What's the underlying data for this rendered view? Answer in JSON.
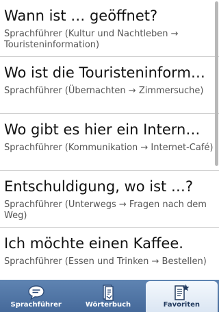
{
  "entries": [
    {
      "title": "Wann ist … geöffnet?",
      "subtitle": "Sprachführer (Kultur und Nachtleben → Touristeninformation)"
    },
    {
      "title": "Wo ist die Touristeninform…",
      "subtitle": "Sprachführer (Übernachten → Zimmersuche)"
    },
    {
      "title": "Wo gibt es hier ein Intern…",
      "subtitle": "Sprachführer (Kommunikation → Internet-Café)"
    },
    {
      "title": "Entschuldigung, wo ist …?",
      "subtitle": "Sprachführer (Unterwegs → Fragen nach dem Weg)"
    },
    {
      "title": "Ich möchte einen Kaffee.",
      "subtitle": "Sprachführer (Essen und Trinken → Bestellen)"
    }
  ],
  "tabs": [
    {
      "label": "Sprachführer",
      "icon": "speech-bubble-icon",
      "active": false
    },
    {
      "label": "Wörterbuch",
      "icon": "dictionary-icon",
      "active": false
    },
    {
      "label": "Favoriten",
      "icon": "favorites-document-star-icon",
      "active": true
    }
  ],
  "colors": {
    "tabbar": "#4f73a3",
    "active_tab": "#e8eff8"
  }
}
